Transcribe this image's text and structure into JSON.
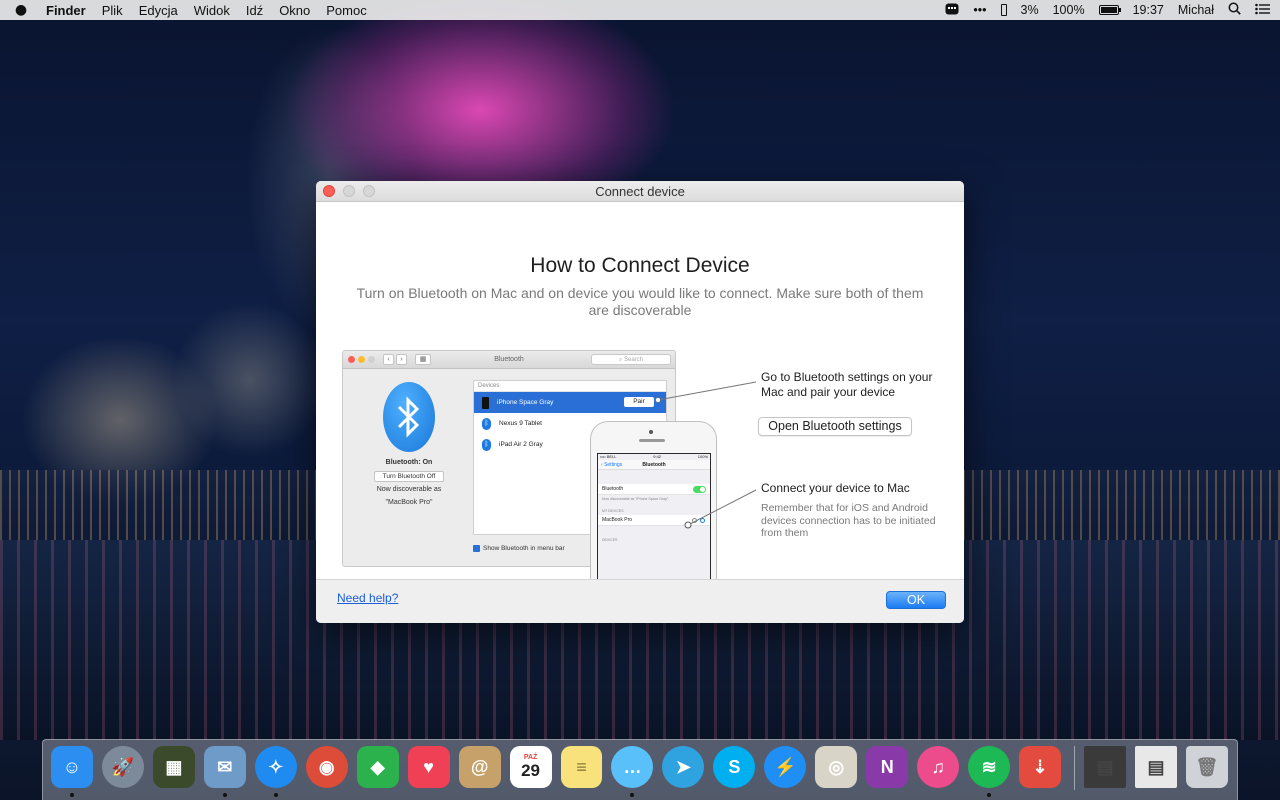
{
  "menubar": {
    "apple_icon": "apple-icon",
    "items": [
      "Finder",
      "Plik",
      "Edycja",
      "Widok",
      "Idź",
      "Okno",
      "Pomoc"
    ],
    "battery_small_percent": "3%",
    "battery_small_level": 0.03,
    "battery_percent": "100%",
    "battery_level": 1.0,
    "time": "19:37",
    "user": "Michał",
    "more_icon": "•••"
  },
  "window": {
    "title": "Connect device",
    "heading": "How to Connect Device",
    "subtitle": "Turn on Bluetooth on Mac and on device you would like to connect. Make sure both of them are discoverable",
    "illustration": {
      "pane_title": "Bluetooth",
      "search_placeholder": "Search",
      "bt_status": "Bluetooth: On",
      "bt_toggle_label": "Turn Bluetooth Off",
      "discoverable_line1": "Now discoverable as",
      "discoverable_line2": "\"MacBook Pro\"",
      "devices_header": "Devices",
      "devices": [
        {
          "name": "iPhone Space Gray",
          "selected": true,
          "action": "Pair"
        },
        {
          "name": "Nexus 9 Tablet",
          "selected": false
        },
        {
          "name": "iPad Air 2 Gray",
          "selected": false
        }
      ],
      "show_in_menu_bar": "Show Bluetooth in menu bar",
      "phone": {
        "carrier": "•••• BELL",
        "time": "9:42",
        "battery": "100%",
        "back_label": "Settings",
        "nav_title": "Bluetooth",
        "bluetooth_label": "Bluetooth",
        "note": "Now discoverable as \"iPhone Space Gray\".",
        "my_devices_header": "MY DEVICES",
        "my_device": "MacBook Pro",
        "devices_header": "DEVICES"
      }
    },
    "step1_text": "Go to Bluetooth settings on your Mac and pair your device",
    "open_bluetooth_button": "Open Bluetooth settings",
    "step2_title": "Connect your device to Mac",
    "step2_note": "Remember that for iOS and Android devices connection has to be initiated from them",
    "help_link": "Need help?",
    "ok_button": "OK"
  },
  "dock": {
    "apps": [
      {
        "name": "finder",
        "color": "#2b8ef0",
        "glyph": "☺",
        "running": true
      },
      {
        "name": "launchpad",
        "color": "#7d8a99",
        "glyph": "🚀",
        "running": false
      },
      {
        "name": "image-capture",
        "color": "#3a4a2a",
        "glyph": "▦",
        "running": false
      },
      {
        "name": "preview",
        "color": "#6f9bc8",
        "glyph": "✉",
        "running": true
      },
      {
        "name": "safari",
        "color": "#1f8bf0",
        "glyph": "✧",
        "running": true
      },
      {
        "name": "chrome",
        "color": "#dd4b39",
        "glyph": "◉",
        "running": false
      },
      {
        "name": "feedly",
        "color": "#2bb24c",
        "glyph": "◆",
        "running": false
      },
      {
        "name": "pocket",
        "color": "#ef4056",
        "glyph": "♥",
        "running": false
      },
      {
        "name": "contacts",
        "color": "#c7a16a",
        "glyph": "@",
        "running": false
      },
      {
        "name": "calendar",
        "color": "#ffffff",
        "glyph": "29",
        "running": false
      },
      {
        "name": "notes",
        "color": "#f7e27b",
        "glyph": "≡",
        "running": false
      },
      {
        "name": "messages",
        "color": "#5ac0fa",
        "glyph": "…",
        "running": true
      },
      {
        "name": "telegram",
        "color": "#2fa3e0",
        "glyph": "➤",
        "running": false
      },
      {
        "name": "skype",
        "color": "#00aff0",
        "glyph": "S",
        "running": false
      },
      {
        "name": "messenger",
        "color": "#1f8ef5",
        "glyph": "⚡",
        "running": false
      },
      {
        "name": "photos-preview",
        "color": "#d9d4c8",
        "glyph": "◎",
        "running": false
      },
      {
        "name": "onenote",
        "color": "#8a3aa8",
        "glyph": "N",
        "running": false
      },
      {
        "name": "itunes",
        "color": "#ec4b8c",
        "glyph": "♫",
        "running": false
      },
      {
        "name": "spotify",
        "color": "#1db954",
        "glyph": "≋",
        "running": true
      },
      {
        "name": "installer",
        "color": "#e34b3f",
        "glyph": "⇣",
        "running": false
      }
    ],
    "stack_icons": [
      "downloads-stack",
      "documents-stack",
      "trash"
    ],
    "calendar_month": "PAŹ",
    "calendar_day": "29"
  }
}
